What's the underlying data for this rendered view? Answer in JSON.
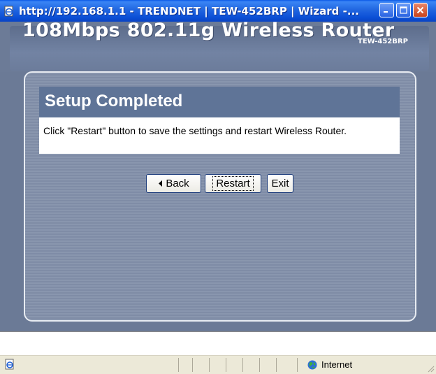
{
  "window": {
    "title": "http://192.168.1.1 - TRENDNET | TEW-452BRP | Wizard -..."
  },
  "banner": {
    "product_title": "108Mbps 802.11g Wireless Router",
    "model": "TEW-452BRP"
  },
  "wizard": {
    "heading": "Setup Completed",
    "message": "Click \"Restart\" button to save the settings and restart Wireless Router.",
    "buttons": {
      "back": "Back",
      "restart": "Restart",
      "exit": "Exit"
    }
  },
  "statusbar": {
    "zone": "Internet"
  }
}
